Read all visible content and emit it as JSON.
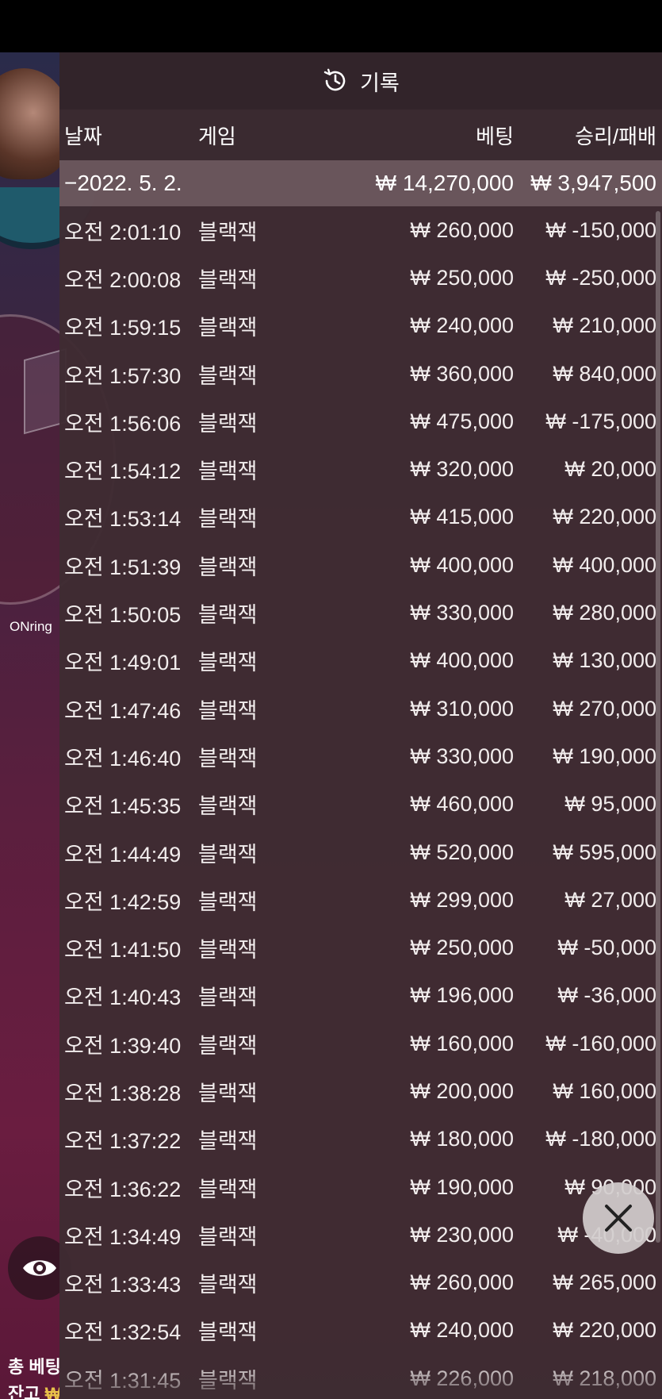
{
  "background": {
    "brand_label": "ONring",
    "total_bet_label": "총 베팅",
    "balance_label": "잔고",
    "currency_glyph": "₩"
  },
  "panel": {
    "title": "기록",
    "icon": "history-icon",
    "columns": {
      "date": "날짜",
      "game": "게임",
      "bet": "베팅",
      "win_loss": "승리/패배"
    },
    "date_group": {
      "date": "−2022. 5. 2.",
      "bet_total": "₩ 14,270,000",
      "win_loss_total": "₩ 3,947,500"
    },
    "rows": [
      {
        "time": "오전 2:01:10",
        "game": "블랙잭",
        "bet": "₩ 260,000",
        "result": "₩ -150,000"
      },
      {
        "time": "오전 2:00:08",
        "game": "블랙잭",
        "bet": "₩ 250,000",
        "result": "₩ -250,000"
      },
      {
        "time": "오전 1:59:15",
        "game": "블랙잭",
        "bet": "₩ 240,000",
        "result": "₩ 210,000"
      },
      {
        "time": "오전 1:57:30",
        "game": "블랙잭",
        "bet": "₩ 360,000",
        "result": "₩ 840,000"
      },
      {
        "time": "오전 1:56:06",
        "game": "블랙잭",
        "bet": "₩ 475,000",
        "result": "₩ -175,000"
      },
      {
        "time": "오전 1:54:12",
        "game": "블랙잭",
        "bet": "₩ 320,000",
        "result": "₩ 20,000"
      },
      {
        "time": "오전 1:53:14",
        "game": "블랙잭",
        "bet": "₩ 415,000",
        "result": "₩ 220,000"
      },
      {
        "time": "오전 1:51:39",
        "game": "블랙잭",
        "bet": "₩ 400,000",
        "result": "₩ 400,000"
      },
      {
        "time": "오전 1:50:05",
        "game": "블랙잭",
        "bet": "₩ 330,000",
        "result": "₩ 280,000"
      },
      {
        "time": "오전 1:49:01",
        "game": "블랙잭",
        "bet": "₩ 400,000",
        "result": "₩ 130,000"
      },
      {
        "time": "오전 1:47:46",
        "game": "블랙잭",
        "bet": "₩ 310,000",
        "result": "₩ 270,000"
      },
      {
        "time": "오전 1:46:40",
        "game": "블랙잭",
        "bet": "₩ 330,000",
        "result": "₩ 190,000"
      },
      {
        "time": "오전 1:45:35",
        "game": "블랙잭",
        "bet": "₩ 460,000",
        "result": "₩ 95,000"
      },
      {
        "time": "오전 1:44:49",
        "game": "블랙잭",
        "bet": "₩ 520,000",
        "result": "₩ 595,000"
      },
      {
        "time": "오전 1:42:59",
        "game": "블랙잭",
        "bet": "₩ 299,000",
        "result": "₩ 27,000"
      },
      {
        "time": "오전 1:41:50",
        "game": "블랙잭",
        "bet": "₩ 250,000",
        "result": "₩ -50,000"
      },
      {
        "time": "오전 1:40:43",
        "game": "블랙잭",
        "bet": "₩ 196,000",
        "result": "₩ -36,000"
      },
      {
        "time": "오전 1:39:40",
        "game": "블랙잭",
        "bet": "₩ 160,000",
        "result": "₩ -160,000"
      },
      {
        "time": "오전 1:38:28",
        "game": "블랙잭",
        "bet": "₩ 200,000",
        "result": "₩ 160,000"
      },
      {
        "time": "오전 1:37:22",
        "game": "블랙잭",
        "bet": "₩ 180,000",
        "result": "₩ -180,000"
      },
      {
        "time": "오전 1:36:22",
        "game": "블랙잭",
        "bet": "₩ 190,000",
        "result": "₩ 90,000"
      },
      {
        "time": "오전 1:34:49",
        "game": "블랙잭",
        "bet": "₩ 230,000",
        "result": "₩ -40,000"
      },
      {
        "time": "오전 1:33:43",
        "game": "블랙잭",
        "bet": "₩ 260,000",
        "result": "₩ 265,000"
      },
      {
        "time": "오전 1:32:54",
        "game": "블랙잭",
        "bet": "₩ 240,000",
        "result": "₩ 220,000"
      },
      {
        "time": "오전 1:31:45",
        "game": "블랙잭",
        "bet": "₩ 226,000",
        "result": "₩ 218,000"
      }
    ]
  },
  "controls": {
    "close_icon": "close-icon",
    "eye_icon": "eye-icon"
  }
}
